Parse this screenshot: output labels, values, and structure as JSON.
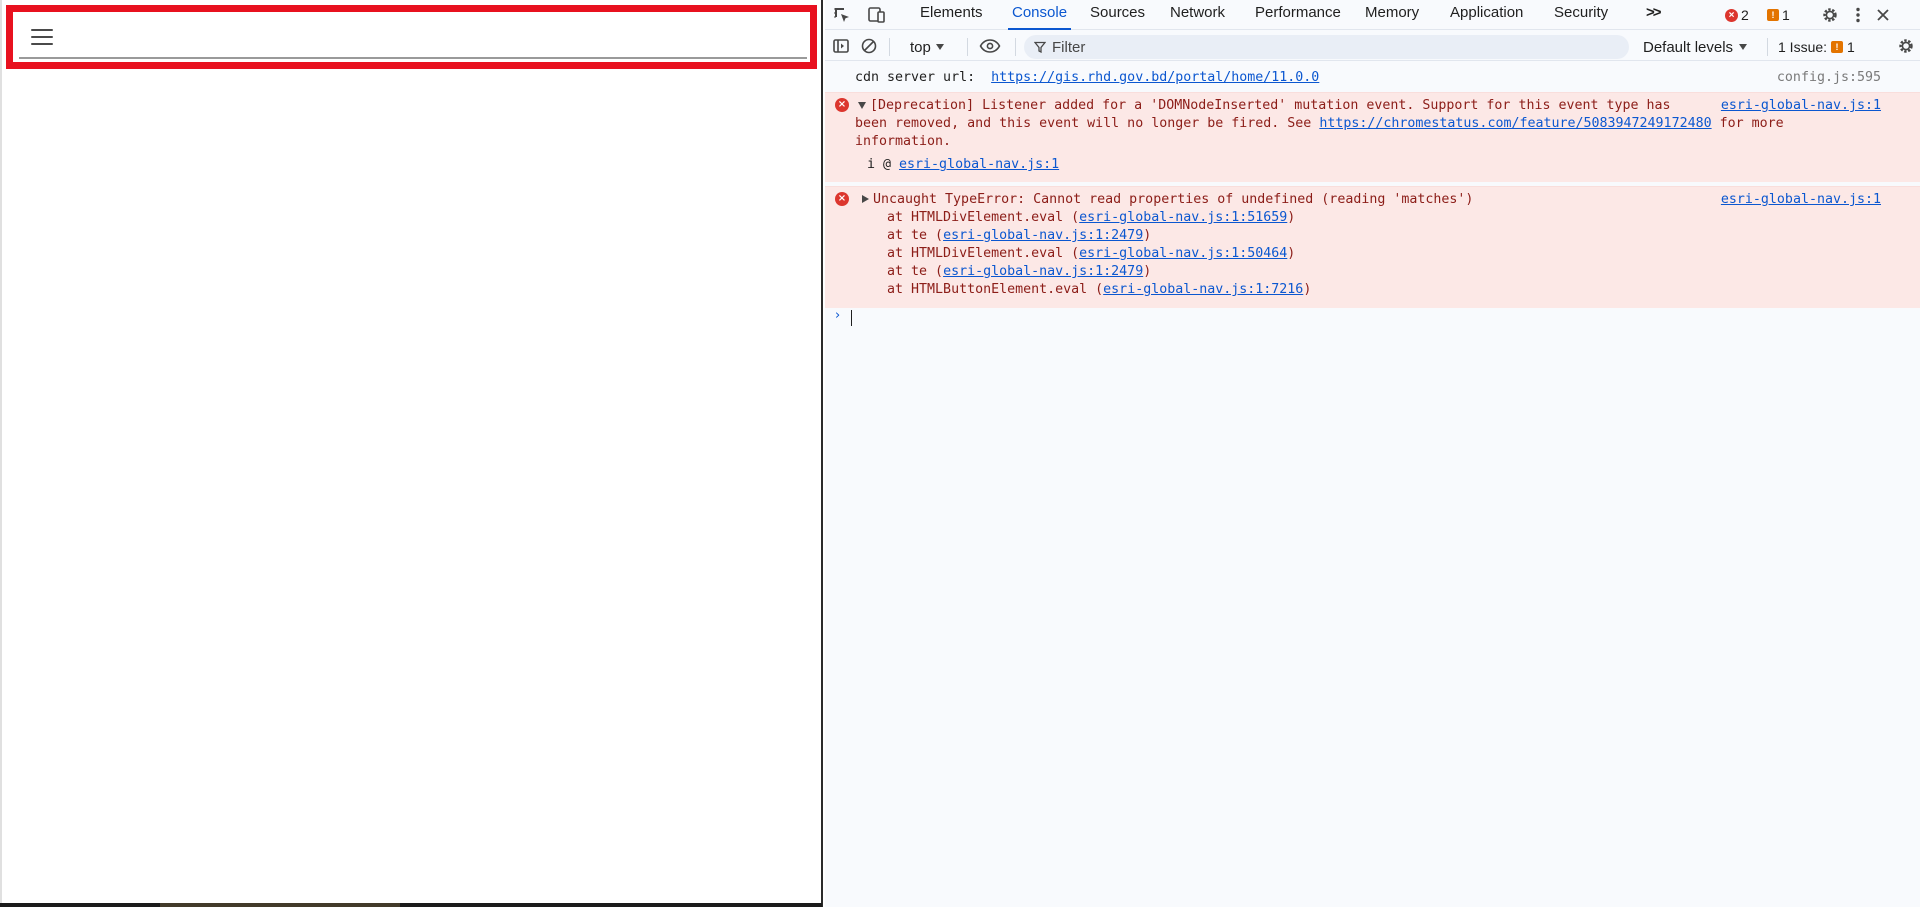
{
  "page": {
    "menu_icon": "hamburger-menu-icon",
    "highlight_color": "#e8111f"
  },
  "devtools": {
    "tabs": [
      "Elements",
      "Console",
      "Sources",
      "Network",
      "Performance",
      "Memory",
      "Application",
      "Security"
    ],
    "active_tab": "Console",
    "more_tabs_label": ">>",
    "error_count": "2",
    "warning_count": "1",
    "console_toolbar": {
      "context": "top",
      "filter_placeholder": "Filter",
      "levels": "Default levels",
      "issues_label": "1 Issue:",
      "issues_count": "1"
    },
    "messages": {
      "log": {
        "text": "cdn server url:  ",
        "url": "https://gis.rhd.gov.bd/portal/home/11.0.0",
        "source": "config.js:595"
      },
      "deprecation": {
        "line1": "[Deprecation] Listener added for a 'DOMNodeInserted' mutation event. Support for this event type has",
        "line2_prefix": "been removed, and this event will no longer be fired. See ",
        "line2_link": "https://chromestatus.com/feature/5083947249172480",
        "line2_suffix": " for more",
        "line3": "information.",
        "stack_prefix": "i @ ",
        "stack_link": "esri-global-nav.js:1",
        "source": "esri-global-nav.js:1"
      },
      "type_error": {
        "title": "Uncaught TypeError: Cannot read properties of undefined (reading 'matches')",
        "source": "esri-global-nav.js:1",
        "stack": [
          {
            "prefix": "    at HTMLDivElement.eval (",
            "link": "esri-global-nav.js:1:51659",
            "suffix": ")"
          },
          {
            "prefix": "    at te (",
            "link": "esri-global-nav.js:1:2479",
            "suffix": ")"
          },
          {
            "prefix": "    at HTMLDivElement.eval (",
            "link": "esri-global-nav.js:1:50464",
            "suffix": ")"
          },
          {
            "prefix": "    at te (",
            "link": "esri-global-nav.js:1:2479",
            "suffix": ")"
          },
          {
            "prefix": "    at HTMLButtonElement.eval (",
            "link": "esri-global-nav.js:1:7216",
            "suffix": ")"
          }
        ]
      }
    },
    "prompt_symbol": "›"
  }
}
